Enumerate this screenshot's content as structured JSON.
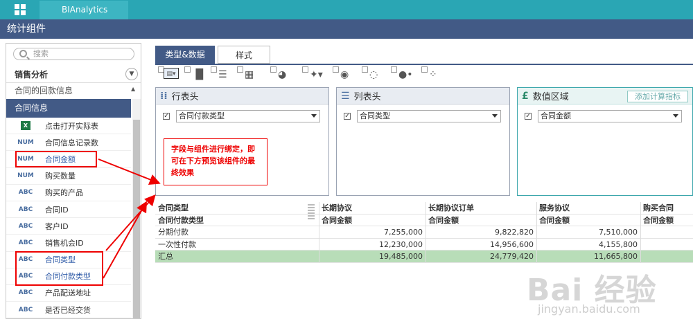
{
  "app": {
    "tab_label": "BIAnalytics",
    "page_title": "统计组件"
  },
  "sidebar": {
    "search_placeholder": "搜索",
    "section_title": "销售分析",
    "sub_item": "合同的回款信息",
    "group_header": "合同信息",
    "fields": [
      {
        "type": "excel",
        "tag": "X",
        "label": "点击打开实际表"
      },
      {
        "type": "num",
        "tag": "NUM",
        "label": "合同信息记录数"
      },
      {
        "type": "num",
        "tag": "NUM",
        "label": "合同金额",
        "selected": true
      },
      {
        "type": "num",
        "tag": "NUM",
        "label": "购买数量"
      },
      {
        "type": "abc",
        "tag": "ABC",
        "label": "购买的产品"
      },
      {
        "type": "abc",
        "tag": "ABC",
        "label": "合同ID"
      },
      {
        "type": "abc",
        "tag": "ABC",
        "label": "客户ID"
      },
      {
        "type": "abc",
        "tag": "ABC",
        "label": "销售机会ID"
      },
      {
        "type": "abc",
        "tag": "ABC",
        "label": "合同类型",
        "selected": true
      },
      {
        "type": "abc",
        "tag": "ABC",
        "label": "合同付款类型",
        "selected": true
      },
      {
        "type": "abc",
        "tag": "ABC",
        "label": "产品配送地址"
      },
      {
        "type": "abc",
        "tag": "ABC",
        "label": "是否已经交货"
      }
    ]
  },
  "tabs": {
    "active": "类型&数据",
    "inactive": "样式"
  },
  "zones": {
    "row": {
      "title": "行表头",
      "field": "合同付款类型"
    },
    "column": {
      "title": "列表头",
      "field": "合同类型"
    },
    "value": {
      "title": "数值区域",
      "field": "合同金额",
      "add_button": "添加计算指标"
    }
  },
  "callout": "字段与组件进行绑定，即可在下方预览该组件的最终效果",
  "table": {
    "corner_top": "合同类型",
    "corner_bottom": "合同付款类型",
    "columns": [
      "长期协议",
      "长期协议订单",
      "服务协议",
      "购买合同"
    ],
    "measure": "合同金额",
    "rows": [
      {
        "label": "分期付款",
        "values": [
          "7,255,000",
          "9,822,820",
          "7,510,000",
          ""
        ]
      },
      {
        "label": "一次性付款",
        "values": [
          "12,230,000",
          "14,956,600",
          "4,155,800",
          ""
        ]
      },
      {
        "label": "汇总",
        "values": [
          "19,485,000",
          "24,779,420",
          "11,665,800",
          ""
        ]
      }
    ]
  },
  "watermark": {
    "brand": "Bai 经验",
    "url": "jingyan.baidu.com"
  },
  "colors": {
    "topbar": "#2aa6b4",
    "title": "#425a86",
    "accent_red": "#e00000",
    "total_row": "#b8ddb8"
  }
}
